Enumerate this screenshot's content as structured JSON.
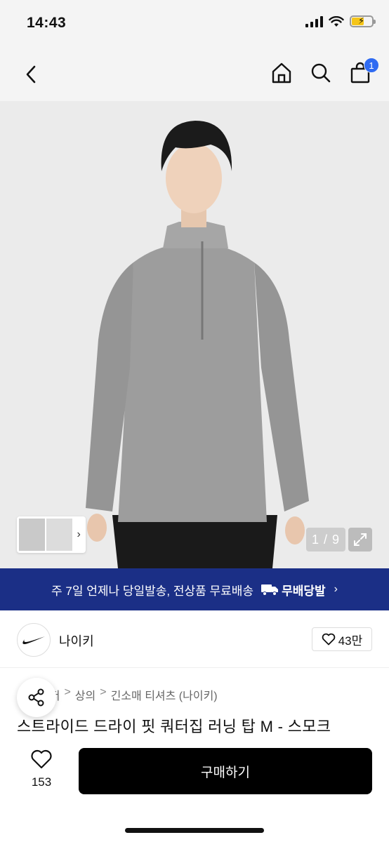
{
  "status_bar": {
    "time": "14:43"
  },
  "header": {
    "cart_count": "1"
  },
  "gallery": {
    "counter": "1 / 9",
    "next_glyph": "›"
  },
  "delivery_banner": {
    "text": "주 7일 언제나 당일발송, 전상품 무료배송",
    "service_name": "무배당발",
    "chevron": "›"
  },
  "brand": {
    "name": "나이키",
    "likes": "43만"
  },
  "breadcrumb": [
    "레저",
    "상의",
    "긴소매 티셔츠 (나이키)"
  ],
  "breadcrumb_separator": ">",
  "product": {
    "title": "스트라이드 드라이 핏 쿼터집 러닝 탑 M - 스모크"
  },
  "action_bar": {
    "wish_count": "153",
    "buy_label": "구매하기"
  },
  "colors": {
    "banner": "#1b2f86",
    "badge": "#2f6bf2",
    "buy_button": "#000000"
  }
}
